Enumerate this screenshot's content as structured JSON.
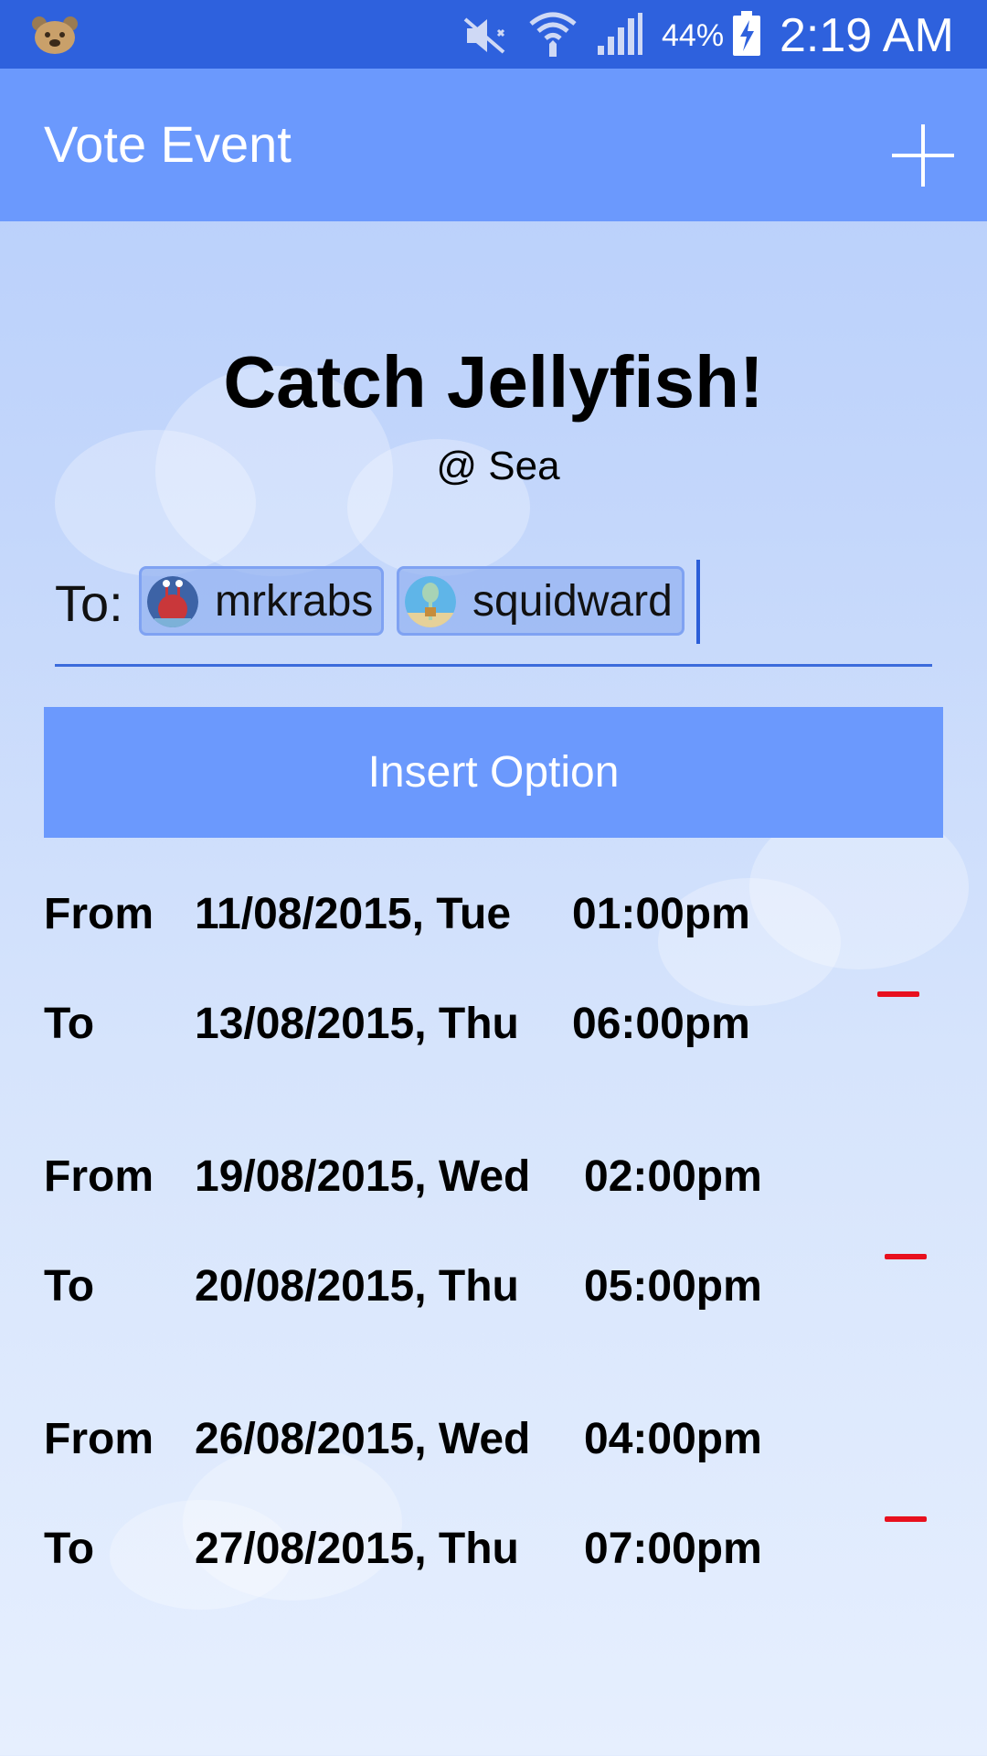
{
  "status_bar": {
    "battery": "44%",
    "time": "2:19 AM"
  },
  "app_bar": {
    "title": "Vote Event"
  },
  "event": {
    "title": "Catch Jellyfish!",
    "location": "@ Sea"
  },
  "recipients": {
    "label": "To:",
    "chips": [
      "mrkrabs",
      "squidward"
    ]
  },
  "insert_button": "Insert Option",
  "options": [
    {
      "from_label": "From",
      "from_date": "11/08/2015, Tue",
      "from_time": "01:00pm",
      "to_label": "To",
      "to_date": "13/08/2015, Thu",
      "to_time": "06:00pm"
    },
    {
      "from_label": "From",
      "from_date": "19/08/2015, Wed",
      "from_time": "02:00pm",
      "to_label": "To",
      "to_date": "20/08/2015, Thu",
      "to_time": "05:00pm"
    },
    {
      "from_label": "From",
      "from_date": "26/08/2015, Wed",
      "from_time": "04:00pm",
      "to_label": "To",
      "to_date": "27/08/2015, Thu",
      "to_time": "07:00pm"
    }
  ],
  "colors": {
    "status_bar": "#2e61dd",
    "app_bar": "#6b99fd",
    "remove": "#e8101e"
  }
}
